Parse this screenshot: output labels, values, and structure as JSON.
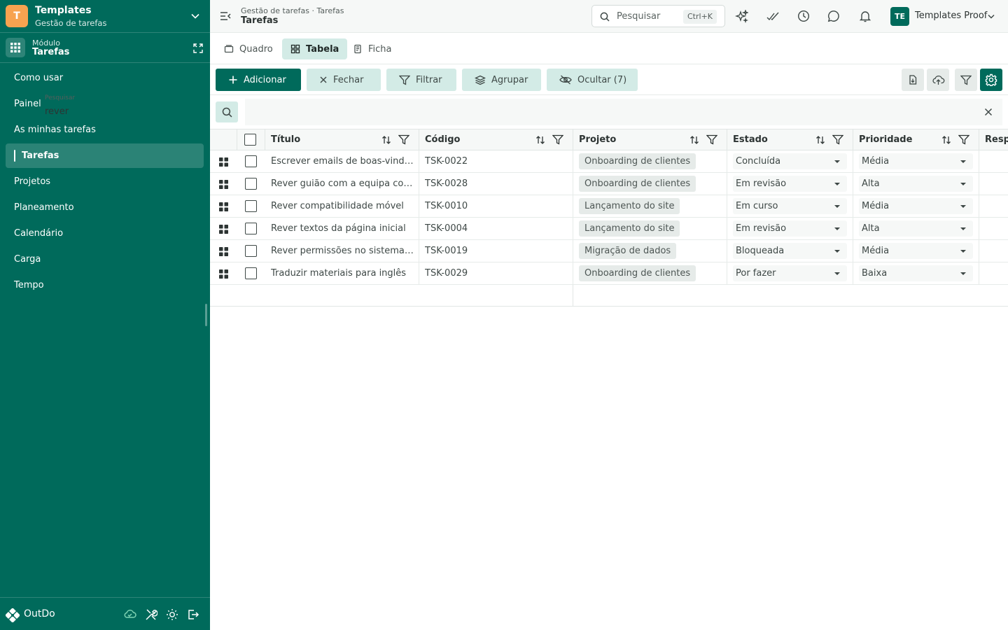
{
  "workspace": {
    "initial": "T",
    "name": "Templates",
    "subtitle": "Gestão de tarefas"
  },
  "module": {
    "caption": "Módulo",
    "name": "Tarefas"
  },
  "nav": {
    "items": [
      {
        "label": "Como usar"
      },
      {
        "label": "Painel"
      },
      {
        "label": "As minhas tarefas"
      },
      {
        "label": "Tarefas",
        "active": true
      },
      {
        "label": "Projetos"
      },
      {
        "label": "Planeamento"
      },
      {
        "label": "Calendário"
      },
      {
        "label": "Carga"
      },
      {
        "label": "Tempo"
      }
    ]
  },
  "footer": {
    "brand": "OutDo"
  },
  "topbar": {
    "breadcrumb": "Gestão de tarefas · Tarefas",
    "title": "Tarefas",
    "search_placeholder": "Pesquisar",
    "search_shortcut": "Ctrl+K",
    "user_initials": "TE",
    "user_name": "Templates Proof"
  },
  "tabs": [
    {
      "label": "Quadro",
      "icon": "board-icon"
    },
    {
      "label": "Tabela",
      "icon": "table-icon",
      "active": true
    },
    {
      "label": "Ficha",
      "icon": "form-icon"
    }
  ],
  "toolbar": {
    "add": "Adicionar",
    "close": "Fechar",
    "filter": "Filtrar",
    "group": "Agrupar",
    "hide": "Ocultar (7)"
  },
  "search_filter": {
    "label": "Pesquisar",
    "value": "rever"
  },
  "table": {
    "columns": [
      "Título",
      "Código",
      "Projeto",
      "Estado",
      "Prioridade",
      "Responsável"
    ],
    "rows": [
      {
        "title": "Escrever emails de boas-vindas",
        "code": "TSK-0022",
        "project": "Onboarding de clientes",
        "status": "Concluída",
        "priority": "Média"
      },
      {
        "title": "Rever guião com a equipa comercial",
        "code": "TSK-0028",
        "project": "Onboarding de clientes",
        "status": "Em revisão",
        "priority": "Alta"
      },
      {
        "title": "Rever compatibilidade móvel",
        "code": "TSK-0010",
        "project": "Lançamento do site",
        "status": "Em curso",
        "priority": "Média"
      },
      {
        "title": "Rever textos da página inicial",
        "code": "TSK-0004",
        "project": "Lançamento do site",
        "status": "Em revisão",
        "priority": "Alta"
      },
      {
        "title": "Rever permissões no sistema novo",
        "code": "TSK-0019",
        "project": "Migração de dados",
        "status": "Bloqueada",
        "priority": "Média"
      },
      {
        "title": "Traduzir materiais para inglês",
        "code": "TSK-0029",
        "project": "Onboarding de clientes",
        "status": "Por fazer",
        "priority": "Baixa"
      }
    ]
  },
  "colors": {
    "brand": "#006a5b",
    "accent_soft": "#d3ebe6",
    "workspace_avatar": "#f7a350"
  }
}
